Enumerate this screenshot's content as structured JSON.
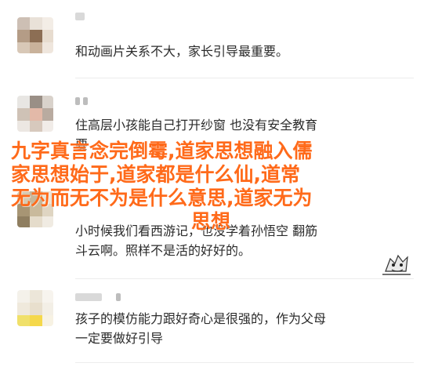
{
  "headline": {
    "line1": "九字真言念完倒霉,道家思想融入儒",
    "line2": "家思想始于,道家都是什么仙,道常",
    "line3": "无为而无不为是什么意思,道家无为",
    "line4": "思想"
  },
  "comments": [
    {
      "lines": [
        "和动画片关系不大，家长引导最重要。"
      ]
    },
    {
      "lines": [
        "住高层小孩能自己打开纱窗 也没有安全教育",
        "要"
      ]
    },
    {
      "lines": [
        "小时候我们看西游记，也没学着孙悟空  翻筋",
        "斗云啊。照样不是活的好好的。"
      ]
    },
    {
      "lines": [
        "孩子的模仿能力跟好奇心是很强的，作为父母",
        "一定要做好引导"
      ]
    }
  ],
  "icons": {
    "avatar": "blurred-avatar-icon",
    "sticker": "cartoon-character-sticker-icon"
  },
  "colors": {
    "headline": "#ff6a1a",
    "text": "#2b2b2b",
    "divider": "#ececec"
  }
}
